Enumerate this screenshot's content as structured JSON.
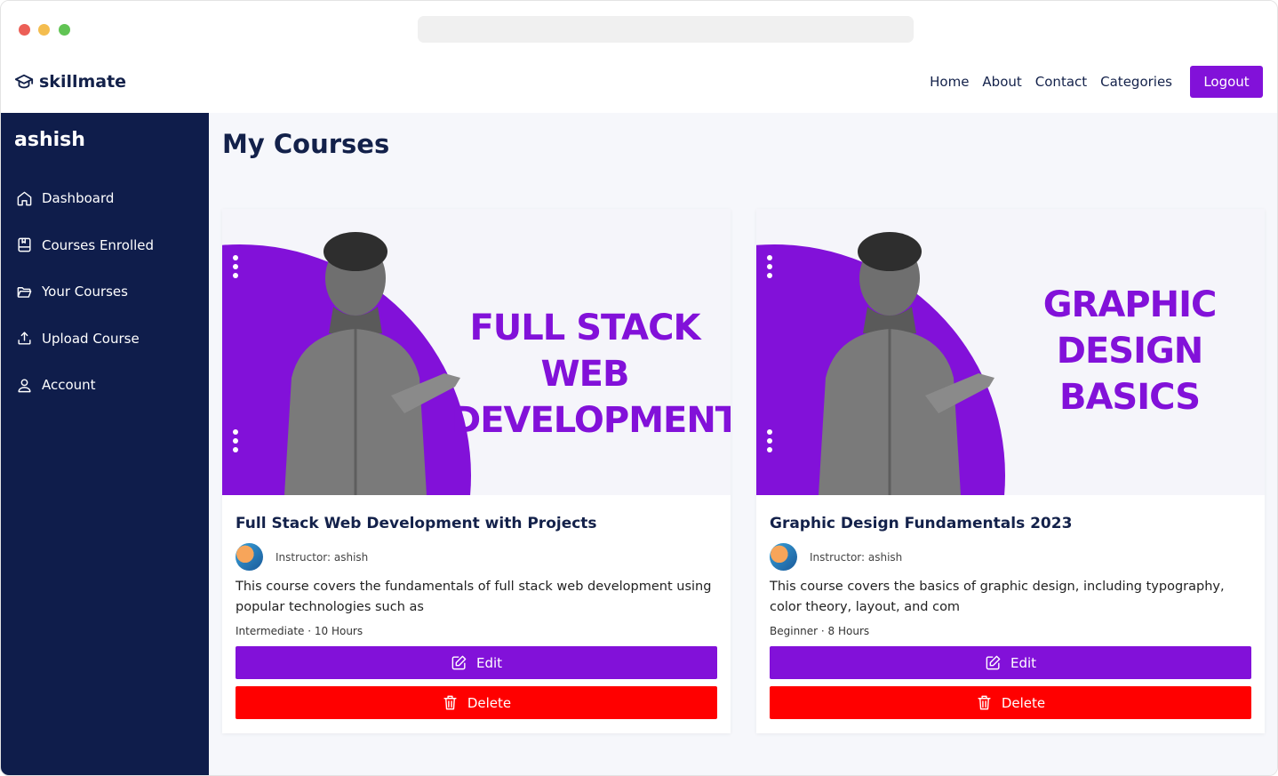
{
  "brand": {
    "name": "skillmate"
  },
  "nav": {
    "links": [
      "Home",
      "About",
      "Contact",
      "Categories"
    ],
    "logout_label": "Logout"
  },
  "sidebar": {
    "user": "ashish",
    "items": [
      {
        "label": "Dashboard",
        "icon": "home-icon"
      },
      {
        "label": "Courses Enrolled",
        "icon": "book-icon"
      },
      {
        "label": "Your Courses",
        "icon": "folder-open-icon"
      },
      {
        "label": "Upload Course",
        "icon": "upload-icon"
      },
      {
        "label": "Account",
        "icon": "user-icon"
      }
    ]
  },
  "main": {
    "title": "My Courses",
    "courses": [
      {
        "banner_line1": "FULL STACK WEB",
        "banner_line2": "DEVELOPMENT",
        "title": "Full Stack Web Development with Projects",
        "instructor": "Instructor: ashish",
        "description": "This course covers the fundamentals of full stack web development using popular technologies such as",
        "meta": "Intermediate · 10 Hours",
        "edit_label": "Edit",
        "delete_label": "Delete"
      },
      {
        "banner_line1": "GRAPHIC",
        "banner_line2": "DESIGN BASICS",
        "title": "Graphic Design Fundamentals 2023",
        "instructor": "Instructor: ashish",
        "description": "This course covers the basics of graphic design, including typography, color theory, layout, and com",
        "meta": "Beginner · 8 Hours",
        "edit_label": "Edit",
        "delete_label": "Delete"
      }
    ]
  },
  "colors": {
    "accent": "#8211d9",
    "sidebar": "#0f1d4b",
    "danger": "#ff0000",
    "text_dark": "#13214a"
  }
}
